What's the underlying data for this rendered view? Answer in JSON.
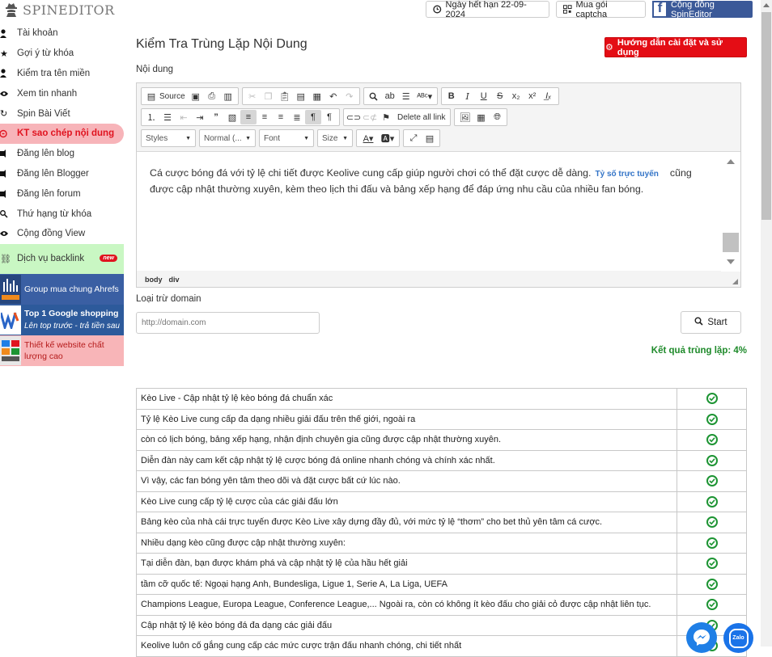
{
  "topbar": {
    "brand": "SPINEDITOR",
    "expiry_label": "Ngày hết hạn 22-09-2024",
    "captcha_label": "Mua gói captcha",
    "community_label": "Cộng đồng SpinEditor"
  },
  "sidebar": {
    "items": [
      {
        "label": "Tài khoản",
        "icon": "user-icon"
      },
      {
        "label": "Gợi ý từ khóa",
        "icon": "star-icon"
      },
      {
        "label": "Kiểm tra tên miền",
        "icon": "user-icon"
      },
      {
        "label": "Xem tin nhanh",
        "icon": "eye-icon"
      },
      {
        "label": "Spin Bài Viết",
        "icon": "refresh-icon"
      },
      {
        "label": "KT sao chép nội dung",
        "icon": "copy-check-icon",
        "active": true
      },
      {
        "label": "Đăng lên blog",
        "icon": "share-icon"
      },
      {
        "label": "Đăng lên Blogger",
        "icon": "share-icon"
      },
      {
        "label": "Đăng lên forum",
        "icon": "share-icon"
      },
      {
        "label": "Thứ hạng từ khóa",
        "icon": "search-icon"
      },
      {
        "label": "Cộng đồng View",
        "icon": "eye-icon"
      }
    ],
    "backlink": {
      "label": "Dịch vụ backlink",
      "badge": "new"
    },
    "promos": {
      "ahrefs": {
        "title": "Group mua chung Ahrefs",
        "thumb": "ahrefs"
      },
      "google": {
        "title": "Top 1 Google shopping",
        "subtitle": "Lên top trước - trả tiền sau"
      },
      "design": {
        "title": "Thiết kế website chất lượng cao"
      }
    }
  },
  "main": {
    "title": "Kiểm Tra Trùng Lặp Nội Dung",
    "guide_button": "Hướng dẫn cài đặt và sử dụng",
    "content_label": "Nội dung",
    "editor": {
      "source_label": "Source",
      "delete_links_label": "Delete all link",
      "styles_label": "Styles",
      "format_label": "Normal (...",
      "font_label": "Font",
      "size_label": "Size",
      "text_before": "Cá cược bóng đá với tỷ lệ chi tiết được Keolive cung cấp giúp người chơi có thể đặt cược dễ dàng.",
      "link_text": "Tỷ số trực tuyến",
      "text_after": "cũng được cập nhật thường xuyên, kèm theo lịch thi đấu và bảng xếp hạng để đáp ứng nhu cầu của nhiều fan bóng.",
      "path": [
        "body",
        "div"
      ]
    },
    "exclude_label": "Loại trừ domain",
    "domain_placeholder": "http://domain.com",
    "start_label": "Start",
    "result_label": "Kết quả trùng lặp: 4%",
    "rows": [
      "Kèo Live - Cập nhật tỷ lệ kèo bóng đá chuẩn xác",
      "Tỷ lệ Kèo Live cung cấp đa dạng nhiều giải đấu trên thế giới, ngoài ra",
      "còn có lịch bóng, bảng xếp hạng, nhận định chuyên gia cũng được cập nhật thường xuyên.",
      "Diễn đàn này cam kết cập nhật tỷ lệ cược bóng đá online nhanh chóng và chính xác nhất.",
      "Vì vậy, các fan bóng yên tâm theo dõi và đặt cược bất cứ lúc nào.",
      "Kèo Live cung cấp tỷ lệ cược của các giải đấu lớn",
      "Bảng kèo của nhà cái trực tuyến được Kèo Live xây dựng đầy đủ, với mức tỷ lệ “thơm” cho bet thủ yên tâm cá cược.",
      "Nhiều dạng kèo cũng được cập nhật thường xuyên:",
      "Tại diễn đàn, bạn được khám phá và cập nhật tỷ lệ của hầu hết giải",
      "tầm cỡ quốc tế: Ngoại hạng Anh, Bundesliga, Ligue 1, Serie A, La Liga, UEFA",
      "Champions League, Europa League, Conference League,... Ngoài ra, còn có không ít kèo đấu cho giải cỏ được cập nhật liên tục.",
      "Cập nhật tỷ lệ kèo bóng đá đa dạng các giải đấu",
      "Keolive luôn cố gắng cung cấp các mức cược trận đấu nhanh chóng, chi tiết nhất"
    ]
  },
  "colors": {
    "accent": "#e40d15",
    "active_bg": "#f7b4b9",
    "success": "#1d9433",
    "facebook": "#3b5998"
  }
}
